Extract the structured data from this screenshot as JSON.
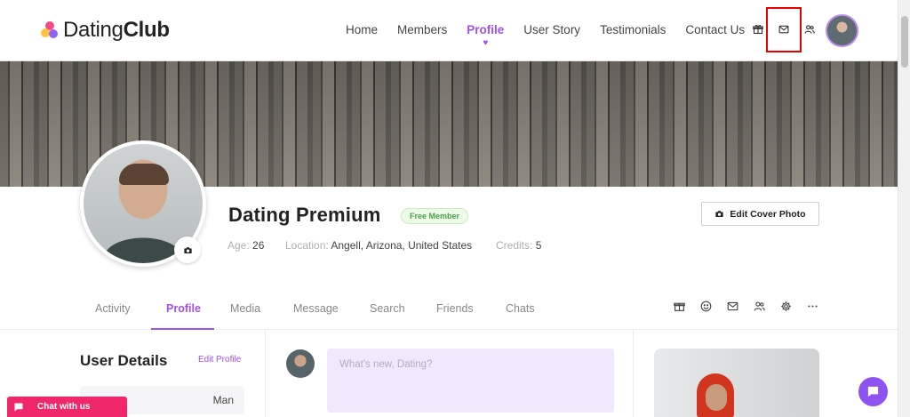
{
  "brand": {
    "light": "Dating",
    "bold": "Club"
  },
  "nav": [
    {
      "label": "Home"
    },
    {
      "label": "Members"
    },
    {
      "label": "Profile",
      "active": true
    },
    {
      "label": "User Story"
    },
    {
      "label": "Testimonials"
    },
    {
      "label": "Contact Us"
    }
  ],
  "header_icons": [
    "gift-icon",
    "mail-icon",
    "users-icon"
  ],
  "profile": {
    "name": "Dating Premium",
    "badge": "Free Member",
    "age_label": "Age:",
    "age": "26",
    "location_label": "Location:",
    "location": "Angell, Arizona, United States",
    "credits_label": "Credits:",
    "credits": "5",
    "edit_cover_label": "Edit Cover Photo"
  },
  "tabs": [
    {
      "label": "Activity"
    },
    {
      "label": "Profile",
      "active": true
    },
    {
      "label": "Media"
    },
    {
      "label": "Message"
    },
    {
      "label": "Search"
    },
    {
      "label": "Friends"
    },
    {
      "label": "Chats"
    }
  ],
  "tab_icons": [
    "gift-icon",
    "smile-icon",
    "mail-icon",
    "users-icon",
    "gear-icon",
    "more-icon"
  ],
  "user_details": {
    "title": "User Details",
    "edit_label": "Edit Profile",
    "gender_value": "Man"
  },
  "post": {
    "placeholder": "What's new, Dating?"
  },
  "chat": {
    "label": "Chat with us"
  },
  "colors": {
    "accent": "#a151f0",
    "chat": "#f0276a",
    "fab": "#8d52ef",
    "highlight": "#e60000"
  }
}
